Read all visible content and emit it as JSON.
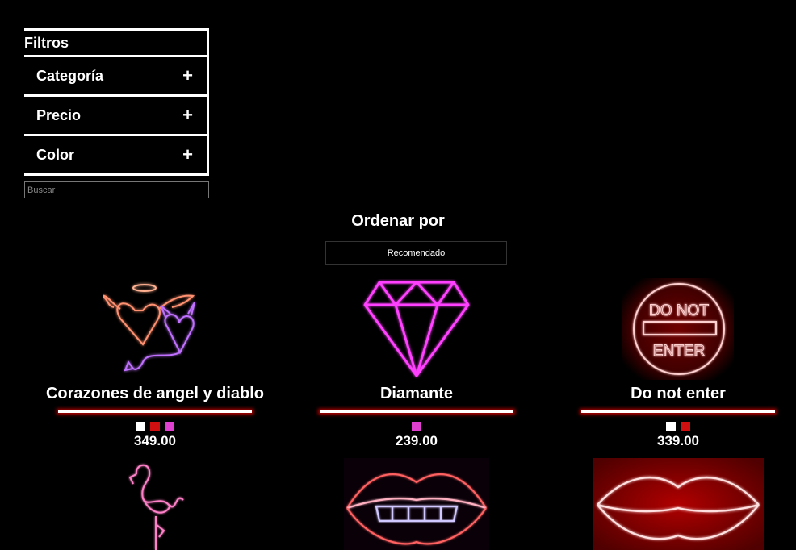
{
  "filters": {
    "title": "Filtros",
    "items": [
      {
        "label": "Categoría",
        "toggle": "+"
      },
      {
        "label": "Precio",
        "toggle": "+"
      },
      {
        "label": "Color",
        "toggle": "+"
      }
    ],
    "search_placeholder": "Buscar"
  },
  "sort": {
    "title": "Ordenar por",
    "selected": "Recomendado"
  },
  "products": [
    {
      "name": "Corazones de angel y diablo",
      "price": "349.00",
      "colors": [
        "#ffffff",
        "#d01010",
        "#e040d0"
      ],
      "icon": "angel-devil-hearts-neon"
    },
    {
      "name": "Diamante",
      "price": "239.00",
      "colors": [
        "#e040d0"
      ],
      "icon": "diamond-neon"
    },
    {
      "name": "Do not enter",
      "price": "339.00",
      "colors": [
        "#ffffff",
        "#d01010"
      ],
      "icon": "do-not-enter-neon"
    }
  ],
  "products_row2": [
    {
      "icon": "flamingo-neon"
    },
    {
      "icon": "lips-biting-neon"
    },
    {
      "icon": "red-lips-neon"
    }
  ],
  "sign_text": {
    "do_not_line1": "DO NOT",
    "do_not_line2": "ENTER"
  }
}
